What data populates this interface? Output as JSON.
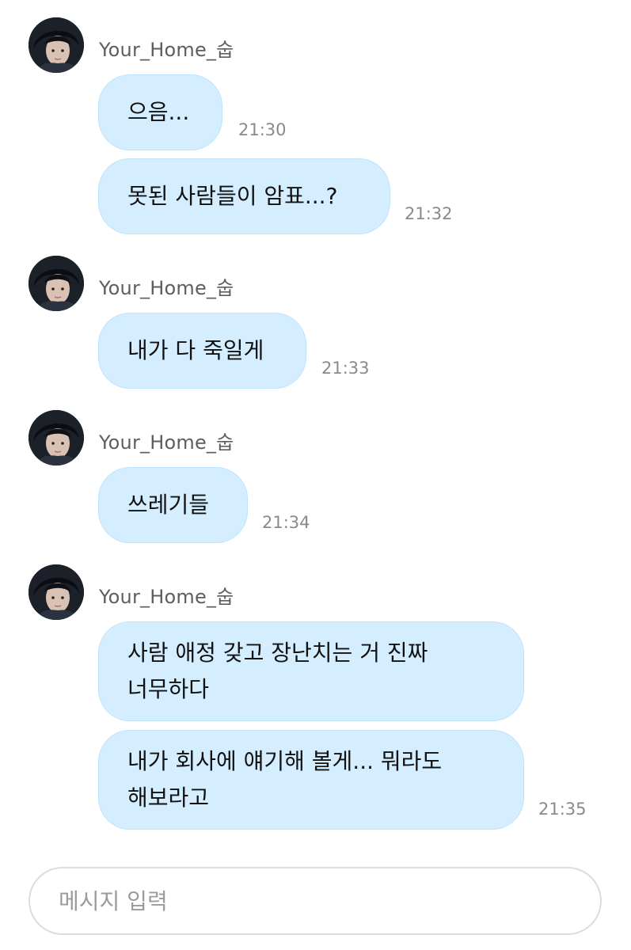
{
  "chat": {
    "groups": [
      {
        "username": "Your_Home_숩",
        "messages": [
          {
            "text": "으음...",
            "time": "21:30"
          },
          {
            "text": "못된 사람들이 암표...?",
            "time": "21:32"
          }
        ]
      },
      {
        "username": "Your_Home_숩",
        "messages": [
          {
            "text": "내가 다 죽일게",
            "time": "21:33"
          }
        ]
      },
      {
        "username": "Your_Home_숩",
        "messages": [
          {
            "text": "쓰레기들",
            "time": "21:34"
          }
        ]
      },
      {
        "username": "Your_Home_숩",
        "messages": [
          {
            "text": "사람 애정 갖고 장난치는 거 진짜\n너무하다",
            "time": ""
          },
          {
            "text": "내가 회사에 얘기해 볼게... 뭐라도\n해보라고",
            "time": "21:35"
          }
        ]
      }
    ]
  },
  "composer": {
    "placeholder": "메시지 입력"
  },
  "colors": {
    "bubble": "#d5eeff",
    "bubble_border": "#bfe3fb",
    "username": "#5e5e5e",
    "time": "#8a8a8a"
  }
}
